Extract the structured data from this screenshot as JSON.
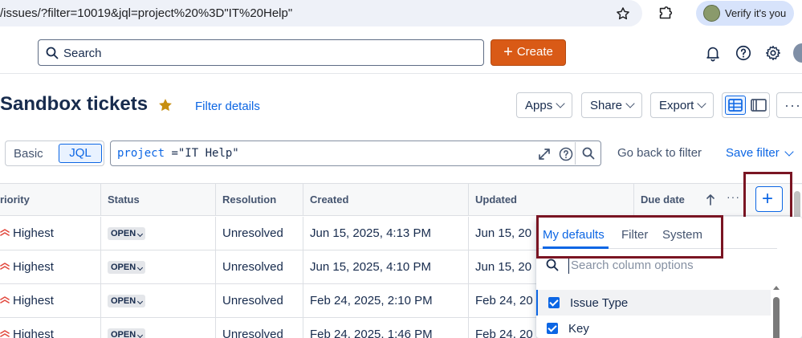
{
  "browser": {
    "url": "/issues/?filter=10019&jql=project%20%3D\"IT%20Help\"",
    "verify_label": "Verify it's you"
  },
  "header": {
    "search_placeholder": "Search",
    "create_label": "Create"
  },
  "page": {
    "title": "Sandbox tickets",
    "filter_details": "Filter details",
    "toolbar": {
      "apps": "Apps",
      "share": "Share",
      "export": "Export"
    }
  },
  "jql": {
    "mode_basic": "Basic",
    "mode_jql": "JQL",
    "query_keyword": "project",
    "query_operator": " =",
    "query_value": "\"IT Help\"",
    "go_back": "Go back to filter",
    "save_filter": "Save filter"
  },
  "table": {
    "columns": [
      "riority",
      "Status",
      "Resolution",
      "Created",
      "Updated",
      "Due date"
    ],
    "rows": [
      {
        "priority": "Highest",
        "status": "OPEN",
        "resolution": "Unresolved",
        "created": "Jun 15, 2025, 4:13 PM",
        "updated": "Jun 15, 20"
      },
      {
        "priority": "Highest",
        "status": "OPEN",
        "resolution": "Unresolved",
        "created": "Jun 15, 2025, 4:10 PM",
        "updated": "Jun 15, 20"
      },
      {
        "priority": "Highest",
        "status": "OPEN",
        "resolution": "Unresolved",
        "created": "Feb 24, 2025, 2:10 PM",
        "updated": "Feb 24, 20"
      },
      {
        "priority": "Highest",
        "status": "OPEN",
        "resolution": "Unresolved",
        "created": "Feb 24, 2025, 1:46 PM",
        "updated": "Feb 24, 20"
      }
    ],
    "priority_color": "#e2483d"
  },
  "column_picker": {
    "tabs": [
      "My defaults",
      "Filter",
      "System"
    ],
    "active_tab": "My defaults",
    "search_placeholder": "Search column options",
    "items": [
      {
        "label": "Issue Type",
        "checked": true
      },
      {
        "label": "Key",
        "checked": true
      }
    ]
  },
  "colors": {
    "accent": "#0c66e4",
    "create_button": "#d95a16",
    "annotation": "#7a1523",
    "title_star": "#c78f0f"
  }
}
